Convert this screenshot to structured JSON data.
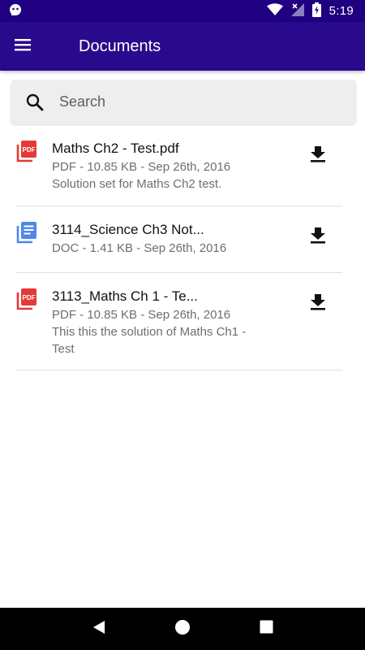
{
  "status_bar": {
    "time": "5:19",
    "icons": [
      "notification-icon",
      "wifi-icon",
      "signal-icon",
      "battery-icon"
    ]
  },
  "app_bar": {
    "title": "Documents",
    "menu_icon": "hamburger-menu-icon"
  },
  "search": {
    "placeholder": "Search",
    "value": ""
  },
  "documents": [
    {
      "type": "pdf",
      "icon": "pdf-file-icon",
      "badge": "PDF",
      "title": "Maths Ch2 - Test.pdf",
      "meta": "PDF - 10.85 KB - Sep 26th, 2016",
      "description": "Solution set for Maths Ch2 test."
    },
    {
      "type": "doc",
      "icon": "doc-file-icon",
      "title": "3114_Science Ch3 Not...",
      "meta": "DOC - 1.41 KB - Sep 26th, 2016",
      "description": ""
    },
    {
      "type": "pdf",
      "icon": "pdf-file-icon",
      "badge": "PDF",
      "title": "3113_Maths Ch 1 - Te...",
      "meta": "PDF - 10.85 KB - Sep 26th, 2016",
      "description": "This this the solution of Maths Ch1 - Test"
    }
  ],
  "colors": {
    "status_bar": "#1f0080",
    "app_bar": "#2a0a8c",
    "pdf_red": "#e53935",
    "doc_blue": "#4f88e8",
    "text_secondary": "#6e6e6e"
  },
  "nav_bar": {
    "icons": [
      "back-icon",
      "home-icon",
      "recents-icon"
    ]
  }
}
